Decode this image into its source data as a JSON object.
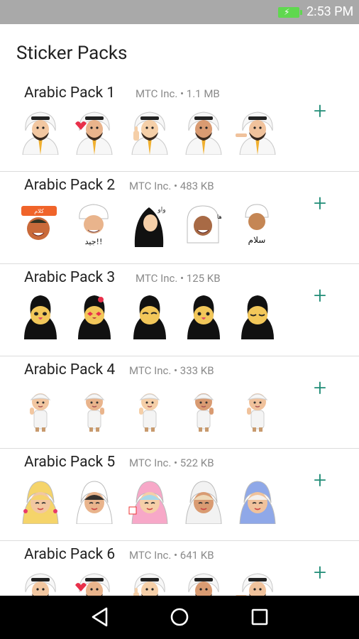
{
  "status_bar": {
    "time": "2:53 PM",
    "battery_icon": "battery-charging-icon"
  },
  "app": {
    "title": "Sticker Packs"
  },
  "packs": [
    {
      "name": "Arabic Pack 1",
      "meta": "MTC Inc. • 1.1 MB",
      "style": "sheikh"
    },
    {
      "name": "Arabic Pack 2",
      "meta": "MTC Inc. • 483 KB",
      "style": "mixed"
    },
    {
      "name": "Arabic Pack 3",
      "meta": "MTC Inc. • 125 KB",
      "style": "niqab"
    },
    {
      "name": "Arabic Pack 4",
      "meta": "MTC Inc. • 333 KB",
      "style": "boy"
    },
    {
      "name": "Arabic Pack 5",
      "meta": "MTC Inc. • 522 KB",
      "style": "girl"
    },
    {
      "name": "Arabic Pack 6",
      "meta": "MTC Inc. • 641 KB",
      "style": "sheikh"
    }
  ],
  "add_symbol": "+",
  "nav": {
    "back_icon": "back-triangle-icon",
    "home_icon": "home-circle-icon",
    "recents_icon": "recents-square-icon"
  },
  "colors": {
    "accent": "#1f8c76",
    "status_bar": "#a9a9a9",
    "nav_bar": "#000000"
  }
}
